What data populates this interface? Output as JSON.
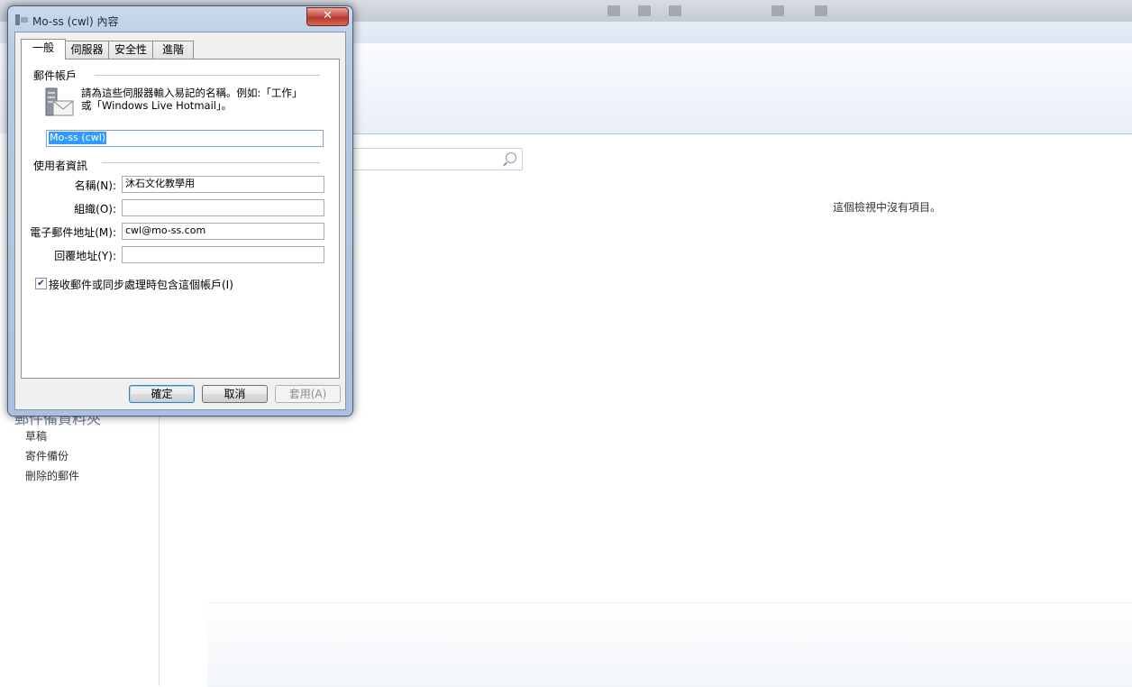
{
  "background_app": {
    "search": {
      "placeholder": ""
    },
    "empty_message": "這個檢視中沒有項目。",
    "folder_section_title": "郵件備資料夾",
    "folders": [
      "草稿",
      "寄件備份",
      "刪除的郵件"
    ]
  },
  "dialog": {
    "title": "Mo-ss (cwl) 內容",
    "close_glyph": "✕",
    "tabs": [
      "一般",
      "伺服器",
      "安全性",
      "進階"
    ],
    "active_tab": "一般",
    "mail_account": {
      "group_title": "郵件帳戶",
      "description_line1": "請為這些伺服器輸入易記的名稱。例如:「工作」",
      "description_line2": "或「Windows Live Hotmail」。",
      "account_name_value": "Mo-ss (cwl)"
    },
    "user_info": {
      "group_title": "使用者資訊",
      "name_label": "名稱(N):",
      "name_value": "沐石文化教學用",
      "org_label": "組織(O):",
      "org_value": "",
      "email_label": "電子郵件地址(M):",
      "email_value": "cwl@mo-ss.com",
      "reply_label": "回覆地址(Y):",
      "reply_value": ""
    },
    "include_checkbox": {
      "label": "接收郵件或同步處理時包含這個帳戶(I)",
      "checked": true,
      "glyph": "✔"
    },
    "buttons": {
      "ok": "確定",
      "cancel": "取消",
      "apply": "套用(A)"
    }
  },
  "colors": {
    "selection": "#3399ff",
    "close_button": "#c75050",
    "dialog_frame": "#b6cbe4"
  }
}
